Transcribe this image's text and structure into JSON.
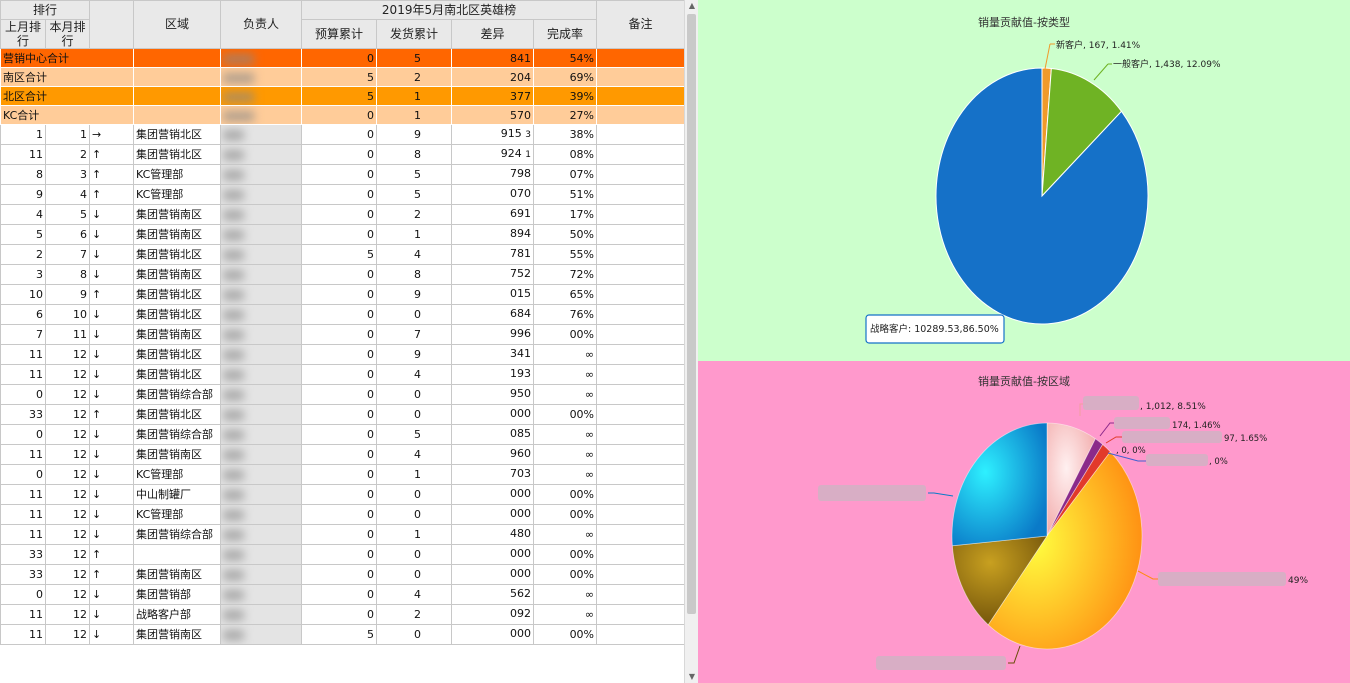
{
  "header": {
    "rank_group": "排行",
    "last_month_rank": "上月排行",
    "this_month_rank": "本月排行",
    "region": "区域",
    "owner": "负责人",
    "report_title": "2019年5月南北区英雄榜",
    "budget": "预算累计",
    "shipped": "发货累计",
    "diff": "差异",
    "rate": "完成率",
    "remark": "备注"
  },
  "summary_rows": [
    {
      "label": "营销中心合计",
      "budget": "0",
      "shipped": "5",
      "diff": "841",
      "rate": "54%",
      "color": "#ff6600"
    },
    {
      "label": "南区合计",
      "budget": "5",
      "shipped": "2",
      "diff": "204",
      "rate": "69%",
      "color": "#ffcc99"
    },
    {
      "label": "北区合计",
      "budget": "5",
      "shipped": "1",
      "diff": "377",
      "rate": "39%",
      "color": "#ff9900"
    },
    {
      "label": "KC合计",
      "budget": "0",
      "shipped": "1",
      "diff": "570",
      "rate": "27%",
      "color": "#ffcc99"
    }
  ],
  "rows": [
    {
      "last": "1",
      "cur": "1",
      "arrow": "→",
      "region": "集团营销北区",
      "budget": "0",
      "shipped": "9",
      "diff": "915",
      "rate": "38%",
      "extra": "3"
    },
    {
      "last": "11",
      "cur": "2",
      "arrow": "↑",
      "region": "集团营销北区",
      "budget": "0",
      "shipped": "8",
      "diff": "924",
      "rate": "08%",
      "extra": "1"
    },
    {
      "last": "8",
      "cur": "3",
      "arrow": "↑",
      "region": "KC管理部",
      "budget": "0",
      "shipped": "5",
      "diff": "798",
      "rate": "07%",
      "extra": ""
    },
    {
      "last": "9",
      "cur": "4",
      "arrow": "↑",
      "region": "KC管理部",
      "budget": "0",
      "shipped": "5",
      "diff": "070",
      "rate": "51%",
      "extra": ""
    },
    {
      "last": "4",
      "cur": "5",
      "arrow": "↓",
      "region": "集团营销南区",
      "budget": "0",
      "shipped": "2",
      "diff": "691",
      "rate": "17%",
      "extra": ""
    },
    {
      "last": "5",
      "cur": "6",
      "arrow": "↓",
      "region": "集团营销南区",
      "budget": "0",
      "shipped": "1",
      "diff": "894",
      "rate": "50%",
      "extra": ""
    },
    {
      "last": "2",
      "cur": "7",
      "arrow": "↓",
      "region": "集团营销北区",
      "budget": "5",
      "shipped": "4",
      "diff": "781",
      "rate": "55%",
      "extra": ""
    },
    {
      "last": "3",
      "cur": "8",
      "arrow": "↓",
      "region": "集团营销南区",
      "budget": "0",
      "shipped": "8",
      "diff": "752",
      "rate": "72%",
      "extra": ""
    },
    {
      "last": "10",
      "cur": "9",
      "arrow": "↑",
      "region": "集团营销北区",
      "budget": "0",
      "shipped": "9",
      "diff": "015",
      "rate": "65%",
      "extra": ""
    },
    {
      "last": "6",
      "cur": "10",
      "arrow": "↓",
      "region": "集团营销北区",
      "budget": "0",
      "shipped": "0",
      "diff": "684",
      "rate": "76%",
      "extra": ""
    },
    {
      "last": "7",
      "cur": "11",
      "arrow": "↓",
      "region": "集团营销南区",
      "budget": "0",
      "shipped": "7",
      "diff": "996",
      "rate": "00%",
      "extra": ""
    },
    {
      "last": "11",
      "cur": "12",
      "arrow": "↓",
      "region": "集团营销北区",
      "budget": "0",
      "shipped": "9",
      "diff": "341",
      "rate": "∞",
      "extra": ""
    },
    {
      "last": "11",
      "cur": "12",
      "arrow": "↓",
      "region": "集团营销北区",
      "budget": "0",
      "shipped": "4",
      "diff": "193",
      "rate": "∞",
      "extra": ""
    },
    {
      "last": "0",
      "cur": "12",
      "arrow": "↓",
      "region": "集团营销综合部",
      "budget": "0",
      "shipped": "0",
      "diff": "950",
      "rate": "∞",
      "extra": "",
      "tall": true
    },
    {
      "last": "33",
      "cur": "12",
      "arrow": "↑",
      "region": "集团营销北区",
      "budget": "0",
      "shipped": "0",
      "diff": "000",
      "rate": "00%",
      "extra": ""
    },
    {
      "last": "0",
      "cur": "12",
      "arrow": "↓",
      "region": "集团营销综合部",
      "budget": "0",
      "shipped": "5",
      "diff": "085",
      "rate": "∞",
      "extra": "",
      "tall": true
    },
    {
      "last": "11",
      "cur": "12",
      "arrow": "↓",
      "region": "集团营销南区",
      "budget": "0",
      "shipped": "4",
      "diff": "960",
      "rate": "∞",
      "extra": ""
    },
    {
      "last": "0",
      "cur": "12",
      "arrow": "↓",
      "region": "KC管理部",
      "budget": "0",
      "shipped": "1",
      "diff": "703",
      "rate": "∞",
      "extra": ""
    },
    {
      "last": "11",
      "cur": "12",
      "arrow": "↓",
      "region": "中山制罐厂",
      "budget": "0",
      "shipped": "0",
      "diff": "000",
      "rate": "00%",
      "extra": ""
    },
    {
      "last": "11",
      "cur": "12",
      "arrow": "↓",
      "region": "KC管理部",
      "budget": "0",
      "shipped": "0",
      "diff": "000",
      "rate": "00%",
      "extra": ""
    },
    {
      "last": "11",
      "cur": "12",
      "arrow": "↓",
      "region": "集团营销综合部",
      "budget": "0",
      "shipped": "1",
      "diff": "480",
      "rate": "∞",
      "extra": "",
      "tall": true
    },
    {
      "last": "33",
      "cur": "12",
      "arrow": "↑",
      "region": "",
      "budget": "0",
      "shipped": "0",
      "diff": "000",
      "rate": "00%",
      "extra": ""
    },
    {
      "last": "33",
      "cur": "12",
      "arrow": "↑",
      "region": "集团营销南区",
      "budget": "0",
      "shipped": "0",
      "diff": "000",
      "rate": "00%",
      "extra": ""
    },
    {
      "last": "0",
      "cur": "12",
      "arrow": "↓",
      "region": "集团营销部",
      "budget": "0",
      "shipped": "4",
      "diff": "562",
      "rate": "∞",
      "extra": ""
    },
    {
      "last": "11",
      "cur": "12",
      "arrow": "↓",
      "region": "战略客户部",
      "budget": "0",
      "shipped": "2",
      "diff": "092",
      "rate": "∞",
      "extra": ""
    },
    {
      "last": "11",
      "cur": "12",
      "arrow": "↓",
      "region": "集团营销南区",
      "budget": "5",
      "shipped": "0",
      "diff": "000",
      "rate": "00%",
      "extra": ""
    }
  ],
  "charts": {
    "type_title": "销量贡献值-按类型",
    "type_labels": [
      "新客户, 167, 1.41%",
      "一般客户, 1,438, 12.09%"
    ],
    "type_tooltip": "战略客户: 10289.53,86.50%",
    "region_title": "销量贡献值-按区域",
    "region_labels": [
      ", 1,012, 8.51%",
      "174, 1.46%",
      "97, 1.65%",
      ", 0, 0%",
      ", 0%",
      "49%"
    ]
  },
  "chart_data": [
    {
      "type": "pie",
      "title": "销量贡献值-按类型",
      "labels": [
        "新客户",
        "一般客户",
        "战略客户"
      ],
      "values": [
        167,
        1438,
        10289.53
      ],
      "percent": [
        1.41,
        12.09,
        86.5
      ],
      "colors": [
        "#f09a2a",
        "#6fb324",
        "#1571c8"
      ]
    },
    {
      "type": "pie",
      "title": "销量贡献值-按区域",
      "values_percent": [
        8.51,
        1.46,
        1.65,
        0,
        0,
        49,
        13,
        26.38
      ],
      "colors": [
        "#f5b6b6",
        "#8b2a8a",
        "#e23a2a",
        "#6060c0",
        "#4060d0",
        "#ffa21a",
        "#8a6a10",
        "#18b8e8"
      ]
    }
  ]
}
